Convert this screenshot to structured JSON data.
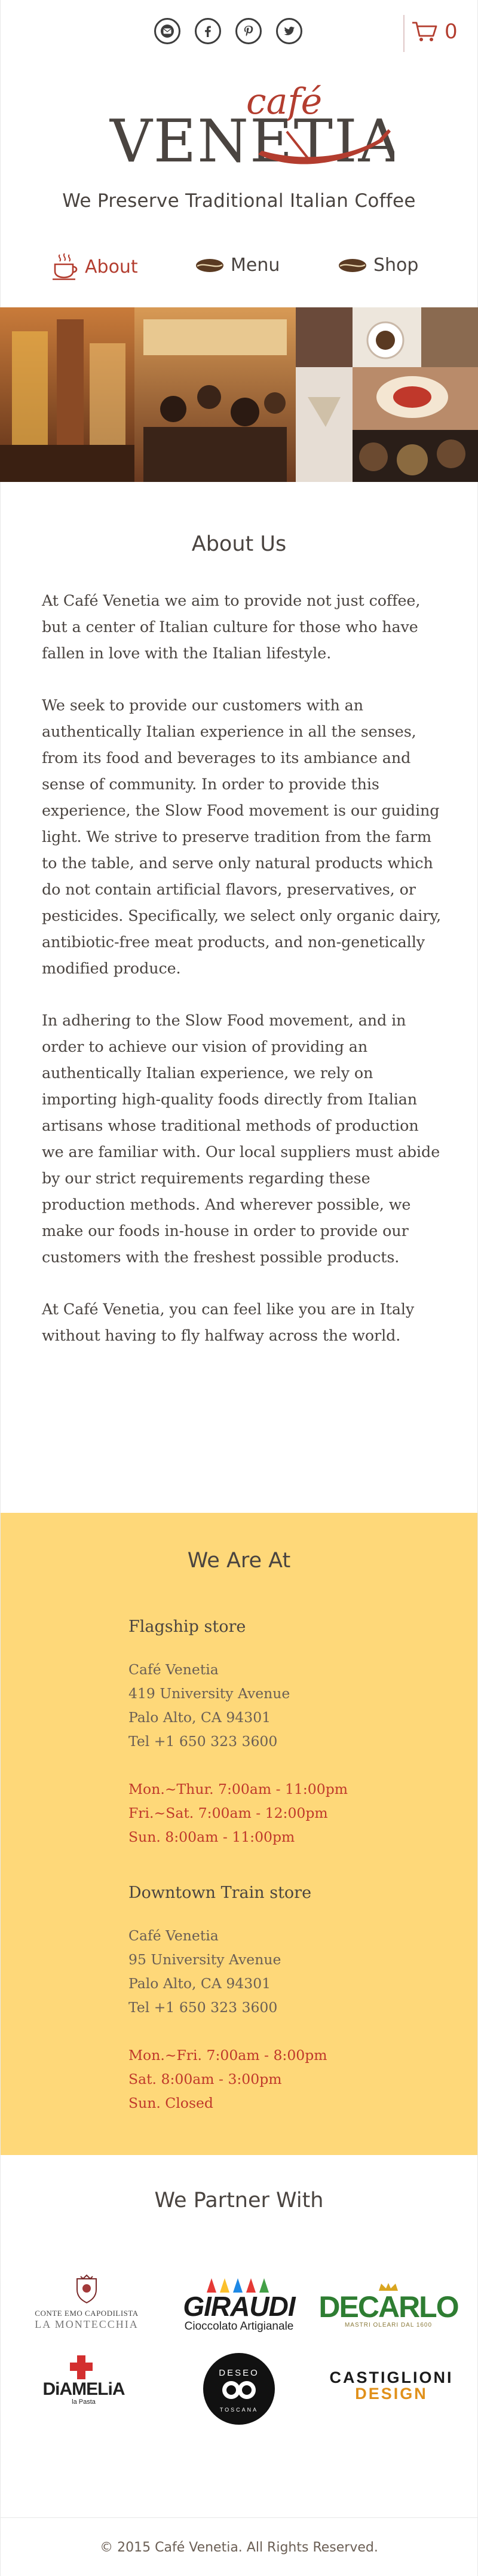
{
  "header": {
    "social": [
      {
        "name": "email",
        "icon": "envelope-icon"
      },
      {
        "name": "facebook",
        "icon": "facebook-icon"
      },
      {
        "name": "pinterest",
        "icon": "pinterest-icon"
      },
      {
        "name": "twitter",
        "icon": "twitter-icon"
      }
    ],
    "cart_count": "0",
    "logo_word_top": "café",
    "logo_word_main": "VENETIA",
    "tagline": "We Preserve Traditional Italian Coffee"
  },
  "nav": {
    "items": [
      {
        "label": "About",
        "active": true,
        "icon": "coffee-cup-icon"
      },
      {
        "label": "Menu",
        "active": false,
        "icon": "coffee-bean-icon"
      },
      {
        "label": "Shop",
        "active": false,
        "icon": "coffee-bean-icon"
      }
    ]
  },
  "about": {
    "title": "About Us",
    "paragraphs": [
      "At Café Venetia we aim to provide not just coffee, but a center of Italian culture for those who have fallen in love with the Italian lifestyle.",
      "We seek to provide our customers with an authentically Italian experience in all the senses, from its food and beverages to its ambiance and sense of community. In order to provide this experience, the Slow Food movement is our guiding light. We strive to preserve tradition from the farm to the table, and serve only natural products which do not contain artificial flavors, preservatives, or pesticides. Specifically, we select only organic dairy, antibiotic-free meat products, and non-genetically modified produce.",
      "In adhering to the Slow Food movement, and in order to achieve our vision of providing an authentically Italian experience, we rely on importing high-quality foods directly from Italian artisans whose traditional methods of production we are familiar with. Our local suppliers must abide by our strict requirements regarding these production methods. And wherever possible, we make our foods in-house in order to provide our customers with the freshest possible products.",
      "At Café Venetia, you can feel like you are in Italy without having to fly halfway across the world."
    ]
  },
  "locations": {
    "title": "We Are At",
    "stores": [
      {
        "name": "Flagship store",
        "lines": [
          "Café Venetia",
          "419 University Avenue",
          "Palo Alto, CA 94301",
          "Tel +1 650 323 3600"
        ],
        "hours": [
          "Mon.~Thur. 7:00am - 11:00pm",
          "Fri.~Sat. 7:00am - 12:00pm",
          "Sun. 8:00am - 11:00pm"
        ]
      },
      {
        "name": "Downtown Train store",
        "lines": [
          "Café Venetia",
          "95 University Avenue",
          "Palo Alto, CA 94301",
          "Tel +1 650 323 3600"
        ],
        "hours": [
          "Mon.~Fri. 7:00am - 8:00pm",
          "Sat. 8:00am - 3:00pm",
          "Sun. Closed"
        ]
      }
    ]
  },
  "partners": {
    "title": "We Partner With",
    "logos": {
      "conte_line1": "CONTE EMO CAPODILISTA",
      "conte_line2": "LA MONTECCHIA",
      "giraudi_main": "GIRAUDI",
      "giraudi_sub": "Cioccolato Artigianale",
      "decarlo_main": "DECARLO",
      "decarlo_sub": "MASTRI OLEARI DAL 1600",
      "diamelia_main": "DiAMELiA",
      "diamelia_sub": "la Pasta",
      "deseo_main": "DESEO",
      "deseo_sub": "TOSCANA",
      "cast_line1": "CASTIGLIONI",
      "cast_line2": "DESIGN"
    }
  },
  "footer": {
    "copyright": "© 2015 Café Venetia. All Rights Reserved."
  },
  "colors": {
    "accent_red": "#b33d2f",
    "location_bg": "#fed879",
    "hours_red": "#c0392b",
    "text": "#4a4440"
  }
}
